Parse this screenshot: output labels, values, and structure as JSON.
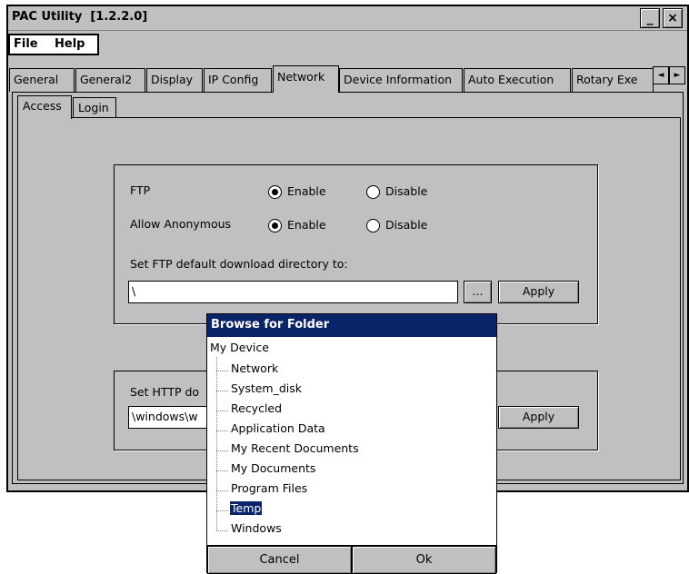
{
  "window": {
    "title": "PAC Utility  [1.2.2.0]",
    "minimize_glyph": "_",
    "close_glyph": "×"
  },
  "menu": {
    "file": "File",
    "help": "Help"
  },
  "tabs": [
    "General",
    "General2",
    "Display",
    "IP Config",
    "Network",
    "Device Information",
    "Auto Execution",
    "Rotary Exe"
  ],
  "active_tab": "Network",
  "tab_scroll": {
    "left": "◄",
    "right": "►"
  },
  "sub_tabs": [
    "Access",
    "Login"
  ],
  "ftp": {
    "ftp_label": "FTP",
    "anon_label": "Allow Anonymous",
    "enable": "Enable",
    "disable": "Disable",
    "dir_label": "Set FTP default download directory to:",
    "dir_value": "\\",
    "browse": "...",
    "apply": "Apply"
  },
  "http": {
    "label": "Set HTTP do",
    "value": "\\windows\\w",
    "apply": "Apply"
  },
  "dialog": {
    "title": "Browse for Folder",
    "root": "My Device",
    "items": [
      "Network",
      "System_disk",
      "Recycled",
      "Application Data",
      "My Recent Documents",
      "My Documents",
      "Program Files",
      "Temp",
      "Windows"
    ],
    "selected": "Temp",
    "cancel": "Cancel",
    "ok": "Ok"
  },
  "colors": {
    "face": "#c0c0c0",
    "title_active": "#0a246a",
    "highlight": "#0a246a"
  }
}
